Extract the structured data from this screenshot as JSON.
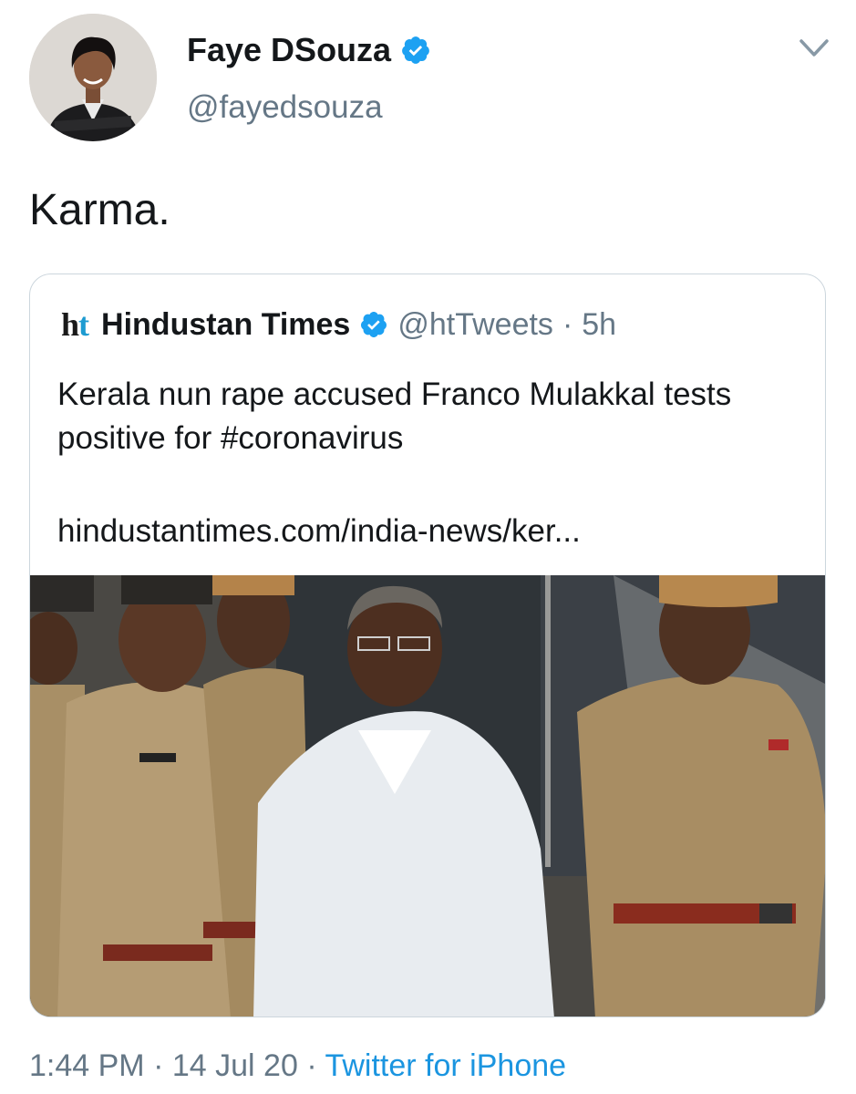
{
  "author": {
    "display_name": "Faye DSouza",
    "handle": "@fayedsouza",
    "verified": true,
    "avatar_icon": "profile-photo"
  },
  "tweet": {
    "text": "Karma."
  },
  "quoted_tweet": {
    "logo_h": "h",
    "logo_t": "t",
    "name": "Hindustan Times",
    "handle": "@htTweets",
    "separator": "·",
    "age": "5h",
    "text": "Kerala nun rape accused Franco Mulakkal tests positive for #coronavirus",
    "link": "hindustantimes.com/india-news/ker...",
    "image_icon": "news-photo"
  },
  "footer": {
    "time": "1:44 PM",
    "sep1": "·",
    "date": "14 Jul 20",
    "sep2": "·",
    "source": "Twitter for iPhone"
  },
  "colors": {
    "verified_blue": "#1da1f2",
    "link_blue": "#1b95e0",
    "muted_gray": "#657786",
    "text_dark": "#14171a",
    "border": "#ccd6dd",
    "ht_logo_blue": "#1d9bd1"
  }
}
